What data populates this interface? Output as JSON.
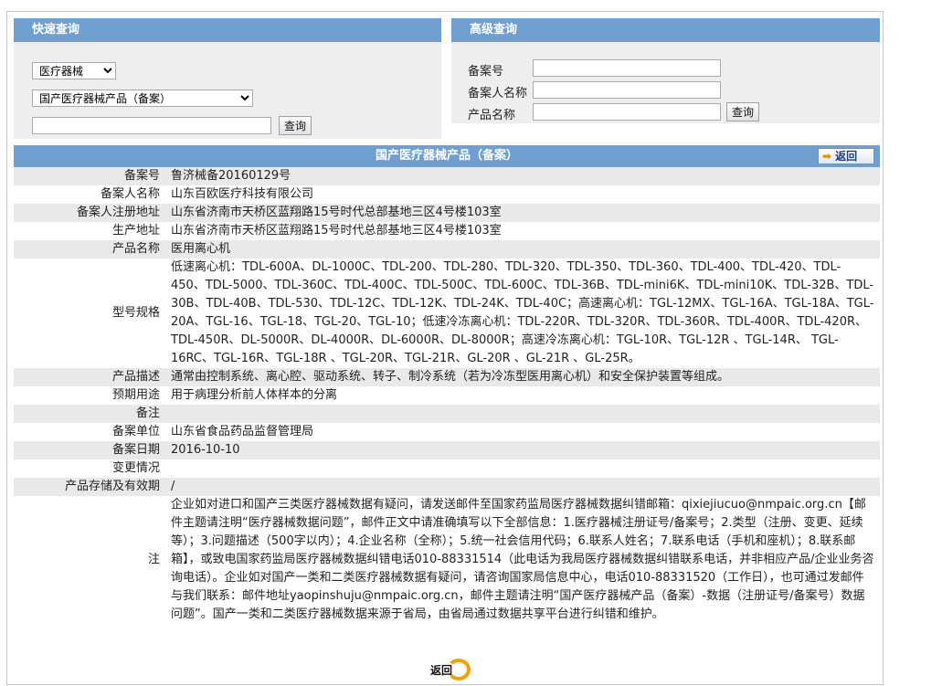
{
  "quick": {
    "title": "快速查询",
    "category": "医疗器械",
    "subcategory": "国产医疗器械产品（备案）",
    "keyword": "",
    "query_label": "查询"
  },
  "advanced": {
    "title": "高级查询",
    "record_no_label": "备案号",
    "filer_label": "备案人名称",
    "product_label": "产品名称",
    "query_label": "查询"
  },
  "detail": {
    "title": "国产医疗器械产品（备案）",
    "back_label": "返回",
    "rows": [
      {
        "key": "备案号",
        "value": "鲁济械备20160129号"
      },
      {
        "key": "备案人名称",
        "value": "山东百欧医疗科技有限公司"
      },
      {
        "key": "备案人注册地址",
        "value": "山东省济南市天桥区蓝翔路15号时代总部基地三区4号楼103室"
      },
      {
        "key": "生产地址",
        "value": "山东省济南市天桥区蓝翔路15号时代总部基地三区4号楼103室"
      },
      {
        "key": "产品名称",
        "value": "医用离心机"
      },
      {
        "key": "型号规格",
        "value": "低速离心机：TDL-600A、DL-1000C、TDL-200、TDL-280、TDL-320、TDL-350、TDL-360、TDL-400、TDL-420、TDL-450、TDL-5000、TDL-360C、TDL-400C、TDL-500C、TDL-600C、TDL-36B、TDL-mini6K、TDL-mini10K、TDL-32B、TDL-30B、TDL-40B、TDL-530、TDL-12C、TDL-12K、TDL-24K、TDL-40C；高速离心机：TGL-12MX、TGL-16A、TGL-18A、TGL-20A、TGL-16、TGL-18、TGL-20、TGL-10；低速冷冻离心机：TDL-220R、TDL-320R、TDL-360R、TDL-400R、TDL-420R、TDL-450R、DL-5000R、DL-4000R、DL-6000R、DL-8000R；高速冷冻离心机：TGL-10R、TGL-12R 、TGL-14R、 TGL-16RC、TGL-16R、TGL-18R 、TGL-20R、TGL-21R、GL-20R 、GL-21R 、GL-25R。"
      },
      {
        "key": "产品描述",
        "value": "通常由控制系统、离心腔、驱动系统、转子、制冷系统（若为冷冻型医用离心机）和安全保护装置等组成。"
      },
      {
        "key": "预期用途",
        "value": "用于病理分析前人体样本的分离"
      },
      {
        "key": "备注",
        "value": ""
      },
      {
        "key": "备案单位",
        "value": "山东省食品药品监督管理局"
      },
      {
        "key": "备案日期",
        "value": "2016-10-10"
      },
      {
        "key": "变更情况",
        "value": ""
      },
      {
        "key": "产品存储及有效期",
        "value": "/"
      }
    ],
    "note_key": "注",
    "note_text": "企业如对进口和国产三类医疗器械数据有疑问，请发送邮件至国家药监局医疗器械数据纠错邮箱：qixiejiucuo@nmpaic.org.cn【邮件主题请注明“医疗器械数据问题”，邮件正文中请准确填写以下全部信息：1.医疗器械注册证号/备案号；2.类型（注册、变更、延续等）；3.问题描述（500字以内）；4.企业名称（全称）；5.统一社会信用代码；6.联系人姓名；7.联系电话（手机和座机）；8.联系邮箱】，或致电国家药监局医疗器械数据纠错电话010-88331514（此电话为我局医疗器械数据纠错联系电话，并非相应产品/企业业务咨询电话）。企业如对国产一类和二类医疗器械数据有疑问，请咨询国家局信息中心，电话010-88331520（工作日），也可通过发邮件与我们联系：邮件地址yaopinshuju@nmpaic.org.cn，邮件主题请注明“国产医疗器械产品（备案）-数据（注册证号/备案号）数据问题”。国产一类和二类医疗器械数据来源于省局，由省局通过数据共享平台进行纠错和维护。"
  },
  "footer": {
    "back_label": "返回"
  },
  "colors": {
    "header_blue": "#6f9fd1",
    "row_gray": "#e9e9e9",
    "note_blue": "#1b3f8f",
    "accent_orange": "#f2a100"
  }
}
